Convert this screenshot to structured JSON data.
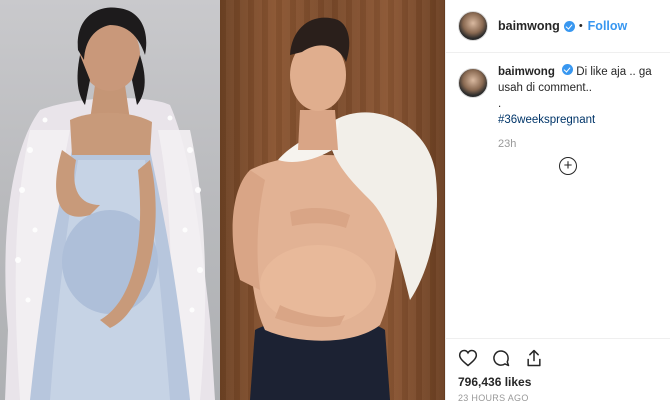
{
  "header": {
    "username": "baimwong",
    "separator": "•",
    "follow_label": "Follow"
  },
  "caption": {
    "username": "baimwong",
    "text": "Di like aja .. ga usah di comment..",
    "dot": ".",
    "hashtag": "#36weekspregnant",
    "time": "23h"
  },
  "likes": "796,436 likes",
  "posted": "23 HOURS AGO",
  "icons": [
    "heart-icon",
    "comment-icon",
    "share-icon",
    "plus-circle-icon",
    "verified-badge-icon"
  ],
  "colors": {
    "follow_blue": "#3897f0",
    "hashtag": "#003569",
    "muted": "#999999"
  }
}
